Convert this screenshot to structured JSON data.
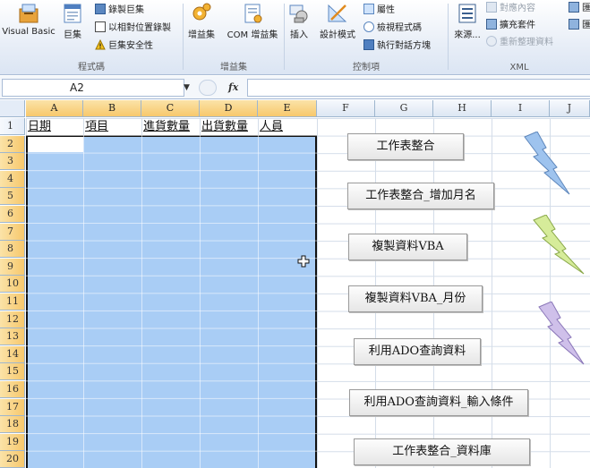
{
  "ribbon": {
    "groups": {
      "code": {
        "label": "程式碼",
        "visual_basic": "Visual Basic",
        "macros": "巨集",
        "record_macro": "錄製巨集",
        "relative_refs": "以相對位置錄製",
        "macro_security": "巨集安全性"
      },
      "addins": {
        "label": "增益集",
        "addins": "增益集",
        "com_addins": "COM 增益集"
      },
      "controls": {
        "label": "控制項",
        "insert": "插入",
        "design_mode": "設計模式",
        "properties": "屬性",
        "view_code": "檢視程式碼",
        "run_dialog": "執行對話方塊"
      },
      "xml": {
        "label": "XML",
        "source": "來源...",
        "map_properties": "對應內容",
        "expansion_packs": "擴充套件",
        "refresh_data": "重新整理資料",
        "import": "匯",
        "export": "匯"
      }
    }
  },
  "formula_bar": {
    "name_box": "A2",
    "fx": "fx",
    "formula": ""
  },
  "sheet": {
    "columns": [
      "A",
      "B",
      "C",
      "D",
      "E",
      "F",
      "G",
      "H",
      "I",
      "J"
    ],
    "rows": [
      "1",
      "2",
      "3",
      "4",
      "5",
      "6",
      "7",
      "8",
      "9",
      "10",
      "11",
      "12",
      "13",
      "14",
      "15",
      "16",
      "17",
      "18",
      "19",
      "20"
    ],
    "headers": {
      "A1": "日期",
      "B1": "項目",
      "C1": "進貨數量",
      "D1": "出貨數量",
      "E1": "人員"
    }
  },
  "macro_buttons": [
    "工作表整合",
    "工作表整合_增加月名",
    "複製資料VBA",
    "複製資料VBA_月份",
    "利用ADO查詢資料",
    "利用ADO查詢資料_輸入條件",
    "工作表整合_資料庫"
  ],
  "colors": {
    "selection": "#a9cdf5",
    "bolt_blue": "#9ec3ee",
    "bolt_green": "#d6ec9a",
    "bolt_purple": "#cfc0ea"
  }
}
